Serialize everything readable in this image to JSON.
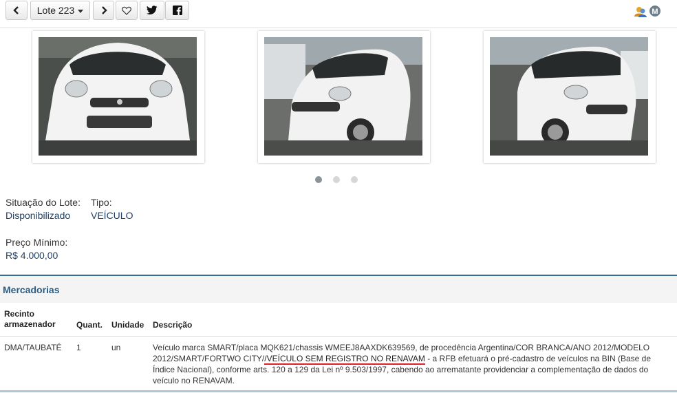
{
  "toolbar": {
    "lote_label": "Lote 223",
    "icons": {
      "prev": "chevron-left-icon",
      "next": "chevron-right-icon",
      "favorite": "heart-icon",
      "twitter": "twitter-icon",
      "facebook": "facebook-icon"
    }
  },
  "user_badge": {
    "letter": "M"
  },
  "gallery": {
    "photos": [
      {
        "subject": "white-smart-car-front"
      },
      {
        "subject": "white-smart-car-front-left"
      },
      {
        "subject": "white-smart-car-front-right"
      }
    ],
    "active_dot": 0,
    "dot_count": 3
  },
  "info": {
    "situacao_label": "Situação do Lote:",
    "situacao_value": "Disponibilizado",
    "tipo_label": "Tipo:",
    "tipo_value": "VEÍCULO",
    "preco_label": "Preço Mínimo:",
    "preco_value": "R$ 4.000,00"
  },
  "mercadorias": {
    "title": "Mercadorias",
    "headers": {
      "recinto_line1": "Recinto",
      "recinto_line2": "armazenador",
      "quant": "Quant.",
      "unidade": "Unidade",
      "descricao": "Descrição"
    },
    "row": {
      "recinto": "DMA/TAUBATÉ",
      "quant": "1",
      "unidade": "un",
      "desc_part1": "Veículo marca SMART/placa MQK621/chassis WMEEJ8AAXDK639569, de procedência Argentina/COR BRANCA/ANO 2012/MODELO 2012/SMART/FORTWO CITY/",
      "desc_highlight": "/VEÍCULO SEM REGISTRO NO RENAVAM",
      "desc_part2": " - a RFB efetuará o pré-cadastro de veículos na BIN (Base de Índice Nacional), conforme arts. 120 a 129 da Lei nº 9.503/1997, cabendo ao arrematante providenciar a complementação de dados do veículo no RENAVAM."
    }
  },
  "colors": {
    "link": "#1f3f66",
    "section_title": "#2a5d84",
    "underline": "#e0202a"
  }
}
